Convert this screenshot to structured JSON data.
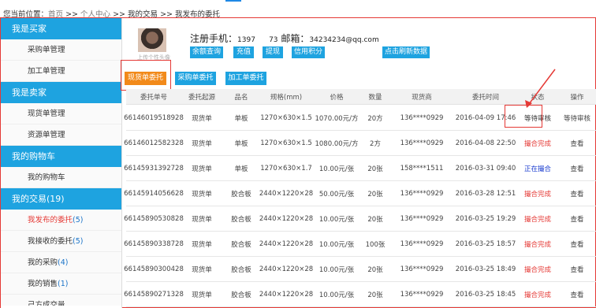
{
  "breadcrumb": {
    "prefix": "您当前位置：",
    "home": "首页",
    "sep": ">>",
    "center": "个人中心",
    "trades": "我的交易",
    "current": "我发布的委托"
  },
  "sidebar": {
    "sections": [
      {
        "title": "我是买家",
        "items": [
          "采购单管理",
          "加工单管理"
        ]
      },
      {
        "title": "我是卖家",
        "items": [
          "现货单管理",
          "资源单管理"
        ]
      },
      {
        "title": "我的购物车",
        "items": [
          "我的购物车"
        ]
      },
      {
        "title": "我的交易(19)",
        "items": [
          "我发布的委托",
          "我接收的委托",
          "我的采购",
          "我的销售"
        ]
      }
    ],
    "trade_counts": [
      "(5)",
      "(5)",
      "(4)",
      "(1)"
    ],
    "bottom_partial": "己方成交量"
  },
  "profile": {
    "avatar_caption": "上传个性头像",
    "reg_label": "注册手机：",
    "phone": "1397      73",
    "email_label": "邮箱：",
    "email": "34234234@qq.com",
    "buttons": [
      "余额查询",
      "充值",
      "提现",
      "信用积分",
      "点击刷新数据"
    ]
  },
  "tabs": [
    "现货单委托",
    "采购单委托",
    "加工单委托"
  ],
  "table": {
    "headers": [
      "委托单号",
      "委托起源",
      "品名",
      "规格(mm)",
      "价格",
      "数量",
      "现货商",
      "委托时间",
      "状态",
      "操作"
    ],
    "rows": [
      [
        "66146019518928",
        "现货单",
        "单板",
        "1270×630×1.5",
        "1070.00元/方",
        "20方",
        "136****0929",
        "2016-04-09 17:46",
        "等待审核",
        "等待审核"
      ],
      [
        "66146012582328",
        "现货单",
        "单板",
        "1270×630×1.5",
        "1080.00元/方",
        "2方",
        "136****0929",
        "2016-04-08 22:50",
        "撮合完成",
        "查看"
      ],
      [
        "66145931392728",
        "现货单",
        "单板",
        "1270×630×1.7",
        "10.00元/张",
        "20张",
        "158****1511",
        "2016-03-31 09:40",
        "正在撮合",
        "查看"
      ],
      [
        "66145914056628",
        "现货单",
        "胶合板",
        "2440×1220×28",
        "50.00元/张",
        "20张",
        "136****0929",
        "2016-03-28 12:51",
        "撮合完成",
        "查看"
      ],
      [
        "66145890530828",
        "现货单",
        "胶合板",
        "2440×1220×28",
        "10.00元/张",
        "20张",
        "136****0929",
        "2016-03-25 19:29",
        "撮合完成",
        "查看"
      ],
      [
        "66145890338728",
        "现货单",
        "胶合板",
        "2440×1220×28",
        "10.00元/张",
        "100张",
        "136****0929",
        "2016-03-25 18:57",
        "撮合完成",
        "查看"
      ],
      [
        "66145890300428",
        "现货单",
        "胶合板",
        "2440×1220×28",
        "10.00元/张",
        "20张",
        "136****0929",
        "2016-03-25 18:49",
        "撮合完成",
        "查看"
      ],
      [
        "66145890271328",
        "现货单",
        "胶合板",
        "2440×1220×28",
        "10.00元/张",
        "20张",
        "136****0929",
        "2016-03-25 18:45",
        "撮合完成",
        "查看"
      ]
    ]
  },
  "colors": {
    "accent_blue": "#1ea3e0",
    "tab_orange": "#f28a1a",
    "status_red": "#e53935",
    "status_blue": "#1a3ccf"
  }
}
